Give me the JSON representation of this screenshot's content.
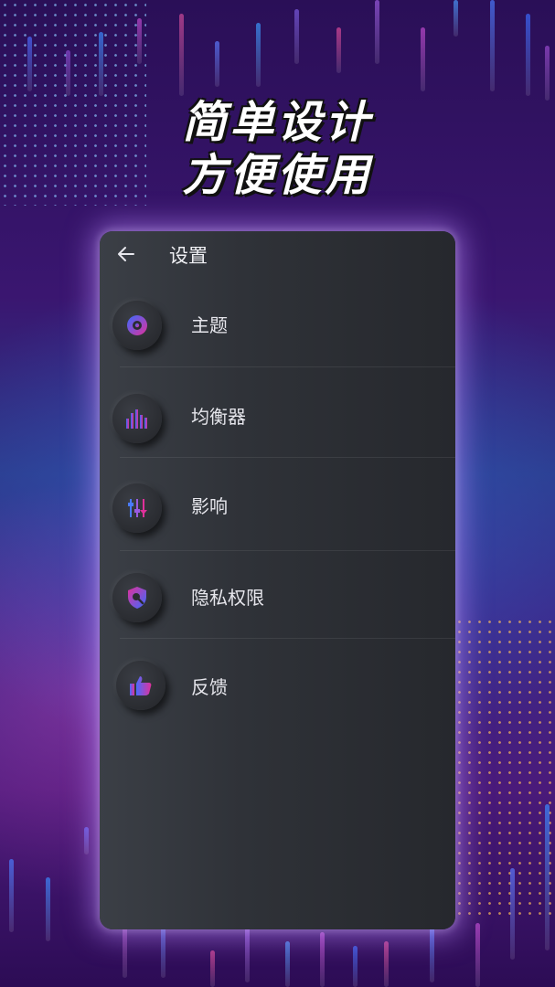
{
  "headline": {
    "line1": "简单设计",
    "line2": "方便使用"
  },
  "screen": {
    "title": "设置",
    "back_icon": "arrow-left-icon"
  },
  "menu": {
    "items": [
      {
        "label": "主题",
        "icon": "theme-disc-icon"
      },
      {
        "label": "均衡器",
        "icon": "equalizer-icon"
      },
      {
        "label": "影响",
        "icon": "sliders-icon"
      },
      {
        "label": "隐私权限",
        "icon": "privacy-shield-icon"
      },
      {
        "label": "反馈",
        "icon": "thumbs-up-icon"
      }
    ]
  },
  "colors": {
    "accent_blue": "#3a6bff",
    "accent_magenta": "#e0309a",
    "panel_bg": "#2f3238"
  }
}
